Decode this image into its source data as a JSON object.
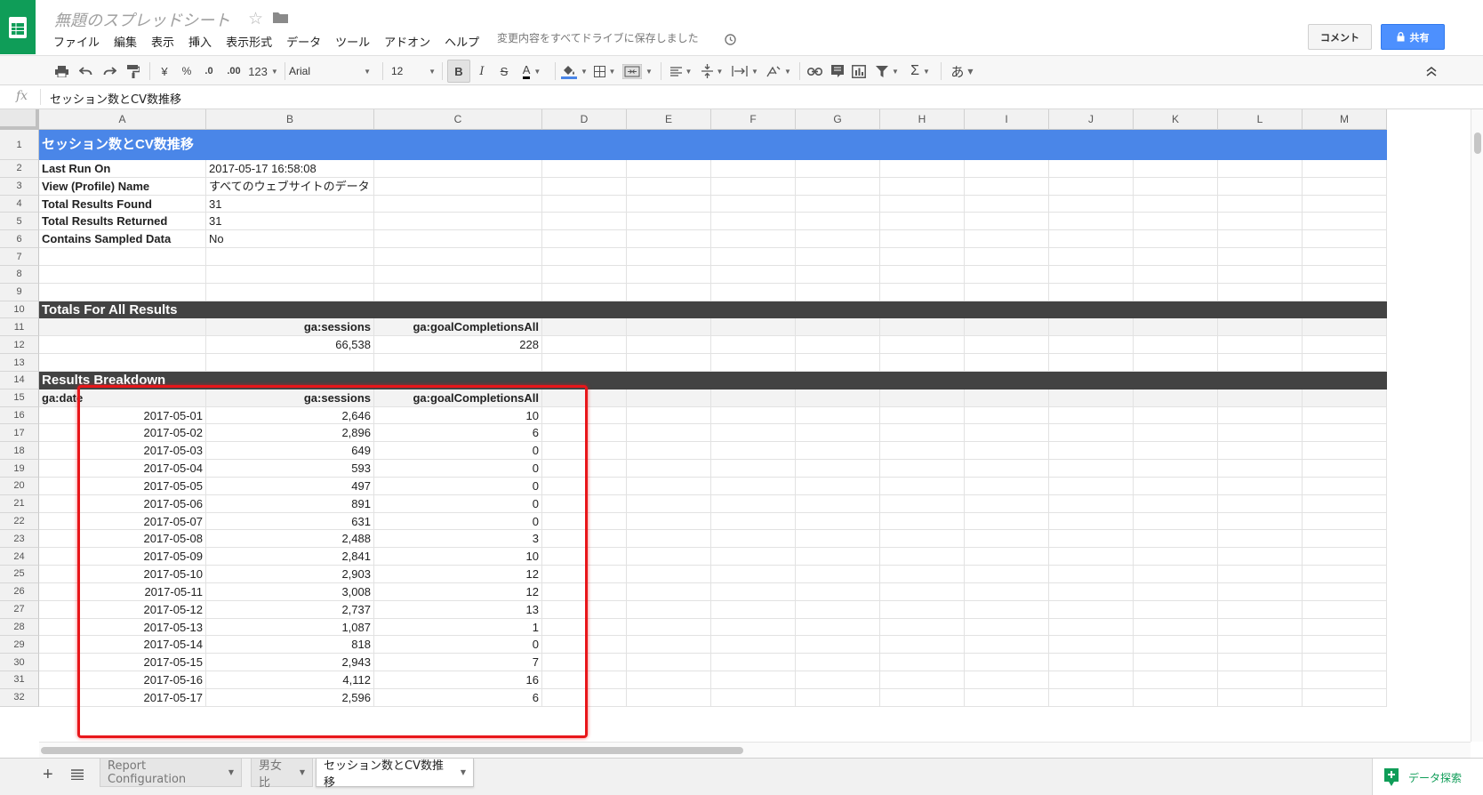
{
  "app": {
    "doc_title": "無題のスプレッドシート",
    "menus": [
      "ファイル",
      "編集",
      "表示",
      "挿入",
      "表示形式",
      "データ",
      "ツール",
      "アドオン",
      "ヘルプ"
    ],
    "save_status": "変更内容をすべてドライブに保存しました",
    "comment_label": "コメント",
    "share_label": "共有",
    "brand_color": "#0f9d58",
    "accent_color": "#4d90fe"
  },
  "toolbar": {
    "currency_label": "¥",
    "percent_label": "%",
    "decrease_decimal_label": ".0",
    "increase_decimal_label": ".00",
    "more_formats_label": "123",
    "font_name": "Arial",
    "font_size": "12",
    "bold_label": "B",
    "italic_label": "I",
    "strike_label": "S",
    "text_color_label": "A",
    "sum_label": "Σ",
    "input_tools_label": "あ"
  },
  "formula_bar": {
    "fx_label": "fx",
    "content": "セッション数とCV数推移"
  },
  "columns": [
    "A",
    "B",
    "C",
    "D",
    "E",
    "F",
    "G",
    "H",
    "I",
    "J",
    "K",
    "L",
    "M"
  ],
  "rows": [
    "1",
    "2",
    "3",
    "4",
    "5",
    "6",
    "7",
    "8",
    "9",
    "10",
    "11",
    "12",
    "13",
    "14",
    "15",
    "16",
    "17",
    "18",
    "19",
    "20",
    "21",
    "22",
    "23",
    "24",
    "25",
    "26",
    "27",
    "28",
    "29",
    "30",
    "31",
    "32"
  ],
  "sheet": {
    "title": "セッション数とCV数推移",
    "info": [
      {
        "label": "Last Run On",
        "value": "2017-05-17 16:58:08"
      },
      {
        "label": "View (Profile) Name",
        "value": "すべてのウェブサイトのデータ"
      },
      {
        "label": "Total Results Found",
        "value": "31"
      },
      {
        "label": "Total Results Returned",
        "value": "31"
      },
      {
        "label": "Contains Sampled Data",
        "value": "No"
      }
    ],
    "totals_title": "Totals For All Results",
    "totals_headers": [
      "",
      "ga:sessions",
      "ga:goalCompletionsAll"
    ],
    "totals_values": [
      "",
      "66,538",
      "228"
    ],
    "breakdown_title": "Results Breakdown",
    "breakdown_headers": [
      "ga:date",
      "ga:sessions",
      "ga:goalCompletionsAll"
    ],
    "breakdown": [
      [
        "2017-05-01",
        "2,646",
        "10"
      ],
      [
        "2017-05-02",
        "2,896",
        "6"
      ],
      [
        "2017-05-03",
        "649",
        "0"
      ],
      [
        "2017-05-04",
        "593",
        "0"
      ],
      [
        "2017-05-05",
        "497",
        "0"
      ],
      [
        "2017-05-06",
        "891",
        "0"
      ],
      [
        "2017-05-07",
        "631",
        "0"
      ],
      [
        "2017-05-08",
        "2,488",
        "3"
      ],
      [
        "2017-05-09",
        "2,841",
        "10"
      ],
      [
        "2017-05-10",
        "2,903",
        "12"
      ],
      [
        "2017-05-11",
        "3,008",
        "12"
      ],
      [
        "2017-05-12",
        "2,737",
        "13"
      ],
      [
        "2017-05-13",
        "1,087",
        "1"
      ],
      [
        "2017-05-14",
        "818",
        "0"
      ],
      [
        "2017-05-15",
        "2,943",
        "7"
      ],
      [
        "2017-05-16",
        "4,112",
        "16"
      ],
      [
        "2017-05-17",
        "2,596",
        "6"
      ]
    ],
    "title_band_color": "#4a86e8",
    "section_band_color": "#434343",
    "highlight_color": "#e8161a"
  },
  "tabs": [
    {
      "label": "Report Configuration",
      "active": false
    },
    {
      "label": "男女比",
      "active": false
    },
    {
      "label": "セッション数とCV数推移",
      "active": true
    }
  ],
  "explore_label": "データ探索"
}
